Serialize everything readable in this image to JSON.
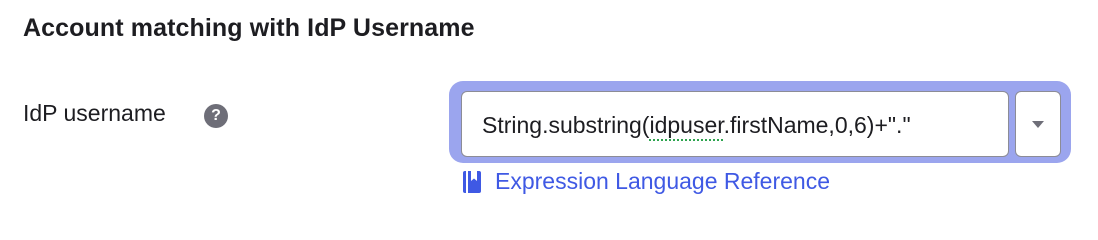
{
  "section": {
    "title": "Account matching with IdP Username"
  },
  "field": {
    "label": "IdP username",
    "help_icon": "question-circle-icon",
    "value_prefix": "String.substring(",
    "value_token": "idpuser",
    "value_suffix": ".firstName,0,6)+\".\"",
    "toggle_icon": "chevron-down-icon"
  },
  "link": {
    "label": "Expression Language Reference",
    "icon": "book-icon"
  },
  "colors": {
    "accent": "#3f59e4",
    "focus_ring": "#9ba5ee",
    "help_icon_bg": "#6e6e78",
    "text": "#1d1d21"
  }
}
